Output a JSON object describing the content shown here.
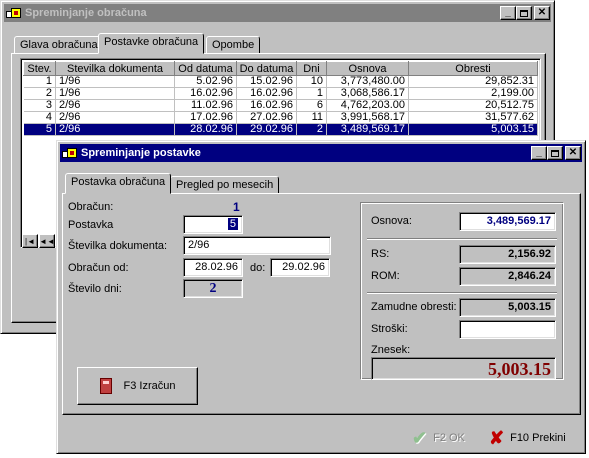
{
  "colors": {
    "bluevalue": "#000080",
    "maroon": "#800000",
    "selection": "#000080"
  },
  "back_window": {
    "title": "Spreminjanje obračuna",
    "tabs": [
      "Glava obračuna",
      "Postavke obračuna",
      "Opombe"
    ],
    "active_tab": 1,
    "columns": [
      "Stev.",
      "Stevilka dokumenta",
      "Od datuma",
      "Do datuma",
      "Dni",
      "Osnova",
      "Obresti"
    ],
    "rows": [
      [
        "1",
        "1/96",
        "5.02.96",
        "15.02.96",
        "10",
        "3,773,480.00",
        "29,852.31"
      ],
      [
        "2",
        "1/96",
        "16.02.96",
        "16.02.96",
        "1",
        "3,068,586.17",
        "2,199.00"
      ],
      [
        "3",
        "2/96",
        "11.02.96",
        "16.02.96",
        "6",
        "4,762,203.00",
        "20,512.75"
      ],
      [
        "4",
        "2/96",
        "17.02.96",
        "27.02.96",
        "11",
        "3,991,568.17",
        "31,577.62"
      ],
      [
        "5",
        "2/96",
        "28.02.96",
        "29.02.96",
        "2",
        "3,489,569.17",
        "5,003.15"
      ]
    ],
    "selected_row": 4,
    "nav_first": "|◄",
    "nav_prev": "◄◄"
  },
  "front_window": {
    "title": "Spreminjanje postavke",
    "tabs": [
      "Postavka obračuna",
      "Pregled po mesecih"
    ],
    "labels": {
      "obracun": "Obračun:",
      "postavka": "Postavka",
      "stevilka": "Številka dokumenta:",
      "obracun_od": "Obračun od:",
      "do": "do:",
      "stevilo_dni": "Število dni:",
      "osnova": "Osnova:",
      "rs": "RS:",
      "rom": "ROM:",
      "zamudne": "Zamudne obresti:",
      "stroski": "Stroški:",
      "znesek": "Znesek:"
    },
    "values": {
      "obracun": "1",
      "postavka": "5",
      "stevilka": "2/96",
      "od": "28.02.96",
      "do": "29.02.96",
      "dni": "2",
      "osnova": "3,489,569.17",
      "rs": "2,156.92",
      "rom": "2,846.24",
      "zamudne": "5,003.15",
      "stroski": "",
      "znesek": "5,003.15"
    },
    "buttons": {
      "izracun": "F3 Izračun",
      "ok": "F2 OK",
      "prekini": "F10 Prekini"
    }
  }
}
